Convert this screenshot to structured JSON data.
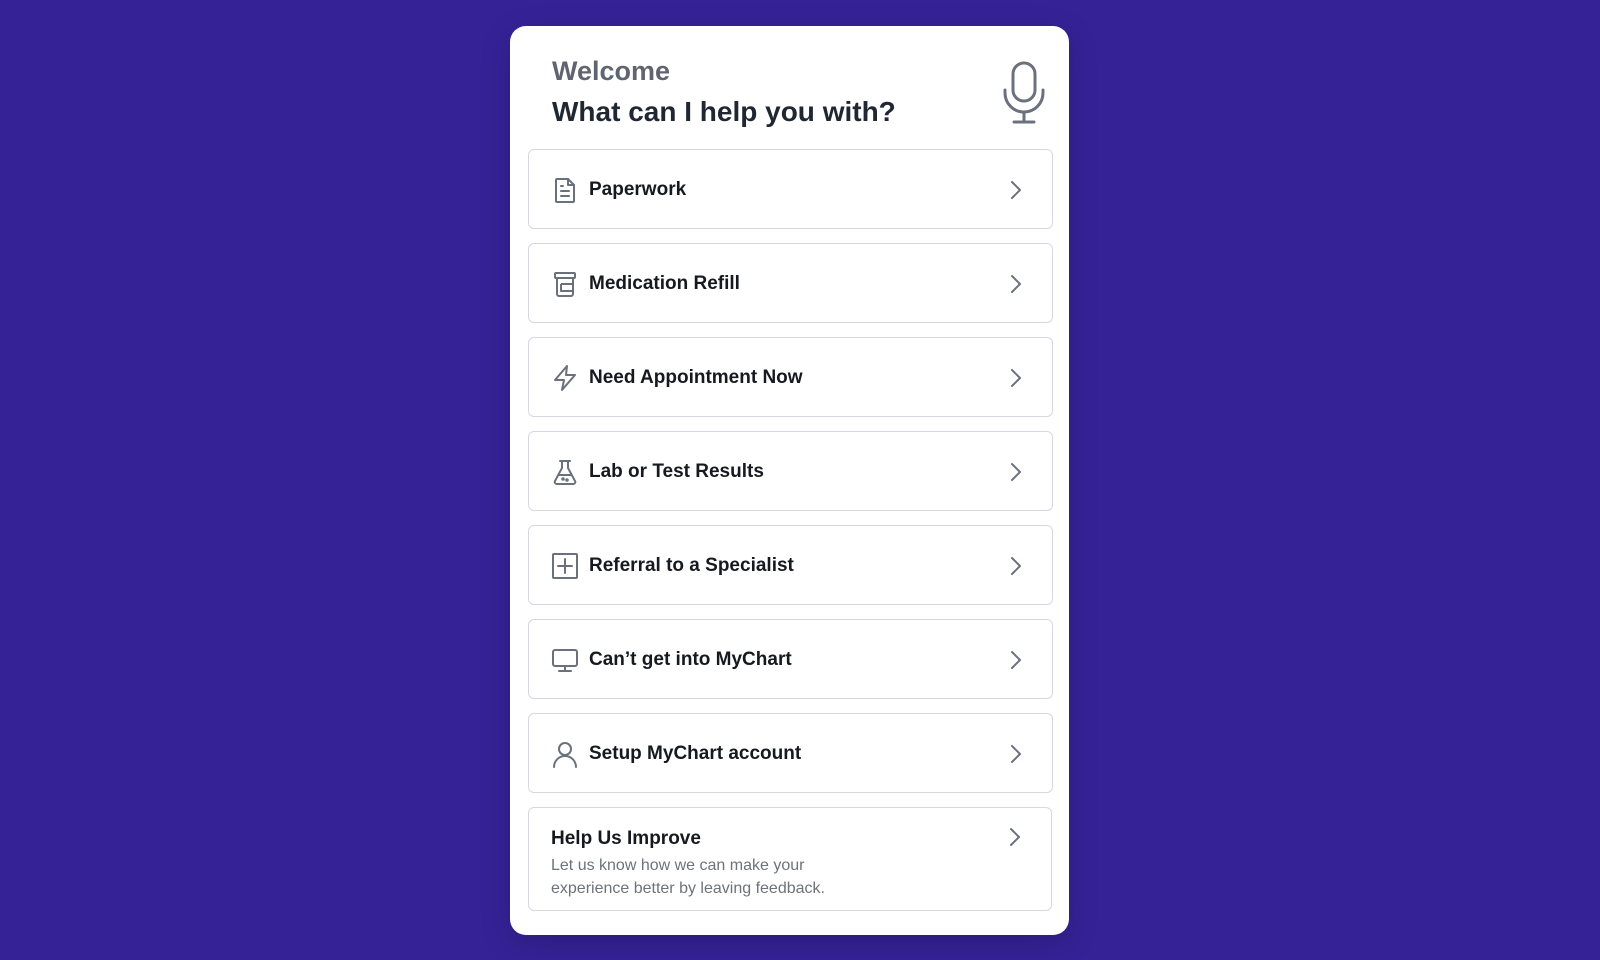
{
  "header": {
    "welcome": "Welcome",
    "prompt": "What can I help you with?",
    "mic_icon": "microphone-icon"
  },
  "menu": {
    "items": [
      {
        "label": "Paperwork",
        "icon": "document-icon"
      },
      {
        "label": "Medication Refill",
        "icon": "pill-bottle-icon"
      },
      {
        "label": "Need Appointment Now",
        "icon": "lightning-icon"
      },
      {
        "label": "Lab or Test Results",
        "icon": "flask-icon"
      },
      {
        "label": "Referral to a Specialist",
        "icon": "plus-square-icon"
      },
      {
        "label": "Can’t get into MyChart",
        "icon": "monitor-icon"
      },
      {
        "label": "Setup MyChart account",
        "icon": "user-icon"
      }
    ]
  },
  "feedback": {
    "title": "Help Us Improve",
    "description": "Let us know how we can make your experience better by leaving feedback."
  },
  "colors": {
    "background": "#352297",
    "card": "#ffffff",
    "icon_stroke": "#6b717c",
    "border": "#d6d8dd"
  }
}
